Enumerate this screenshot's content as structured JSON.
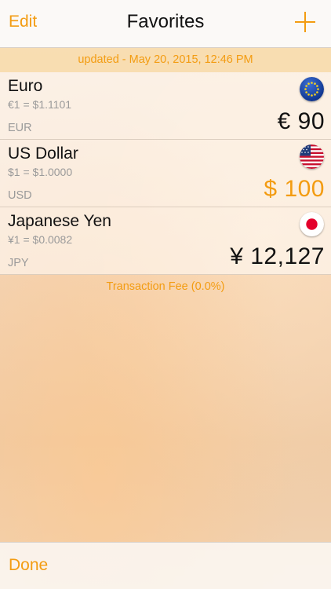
{
  "nav": {
    "edit_label": "Edit",
    "title": "Favorites",
    "add_icon": "plus-icon"
  },
  "updated_text": "updated - May 20, 2015, 12:46 PM",
  "currencies": [
    {
      "name": "Euro",
      "rate": "€1 = $1.1101",
      "code": "EUR",
      "amount": "€ 90",
      "flag": "eu-flag-icon",
      "active": false
    },
    {
      "name": "US Dollar",
      "rate": "$1 = $1.0000",
      "code": "USD",
      "amount": "$ 100",
      "flag": "us-flag-icon",
      "active": true
    },
    {
      "name": "Japanese Yen",
      "rate": "¥1 = $0.0082",
      "code": "JPY",
      "amount": "¥ 12,127",
      "flag": "jp-flag-icon",
      "active": false
    }
  ],
  "transaction_fee": "Transaction Fee (0.0%)",
  "bottom": {
    "done_label": "Done"
  },
  "colors": {
    "accent": "#f39c12",
    "text": "#111111",
    "secondary": "#9a9a9a"
  }
}
